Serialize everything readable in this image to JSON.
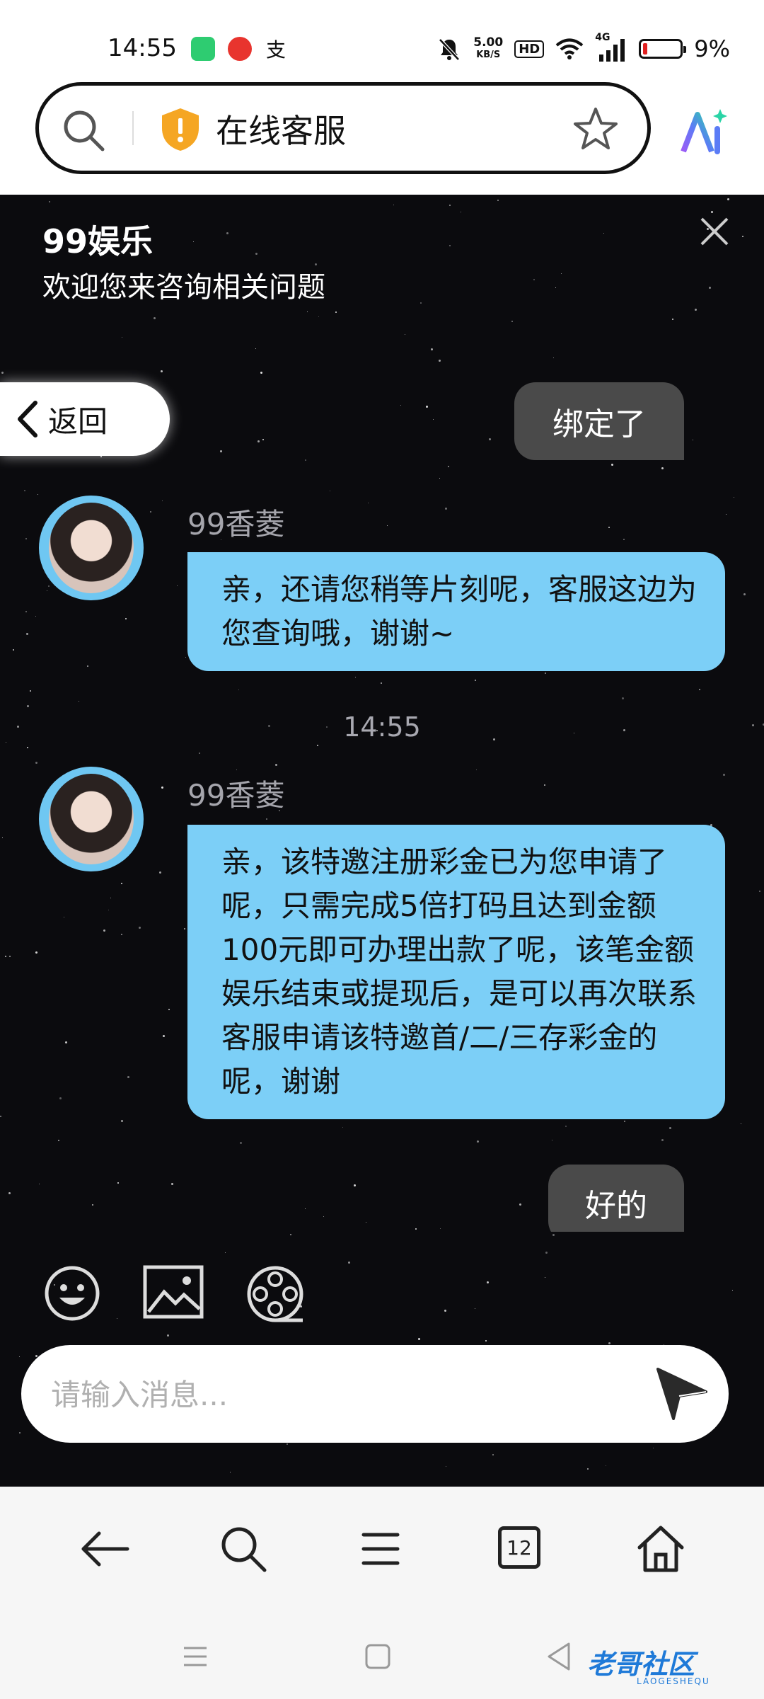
{
  "status": {
    "time": "14:55",
    "net_speed_value": "5.00",
    "net_speed_unit": "KB/S",
    "hd": "HD",
    "network": "4G",
    "battery": "9%"
  },
  "browser": {
    "page_title": "在线客服"
  },
  "chat": {
    "header_title": "99娱乐",
    "header_subtitle": "欢迎您来咨询相关问题",
    "back_label": "返回",
    "messages": [
      {
        "from": "me",
        "text": "绑定了"
      },
      {
        "from": "agent",
        "name": "99香菱",
        "text": "亲，还请您稍等片刻呢，客服这边为您查询哦，谢谢~"
      },
      {
        "from": "time",
        "text": "14:55"
      },
      {
        "from": "agent",
        "name": "99香菱",
        "text": "亲，该特邀注册彩金已为您申请了呢，只需完成5倍打码且达到金额100元即可办理出款了呢，该笔金额娱乐结束或提现后，是可以再次联系客服申请该特邀首/二/三存彩金的呢，谢谢"
      },
      {
        "from": "me",
        "text": "好的"
      }
    ],
    "input_placeholder": "请输入消息..."
  },
  "browser_nav": {
    "tabs_count": "12"
  },
  "watermark": {
    "text": "老哥社区",
    "sub": "LAOGESHEQU"
  },
  "colors": {
    "agent_bubble": "#7ccff7",
    "my_bubble": "#4a4a4a",
    "chat_bg": "#0b0b0e",
    "shield": "#f5a623"
  }
}
